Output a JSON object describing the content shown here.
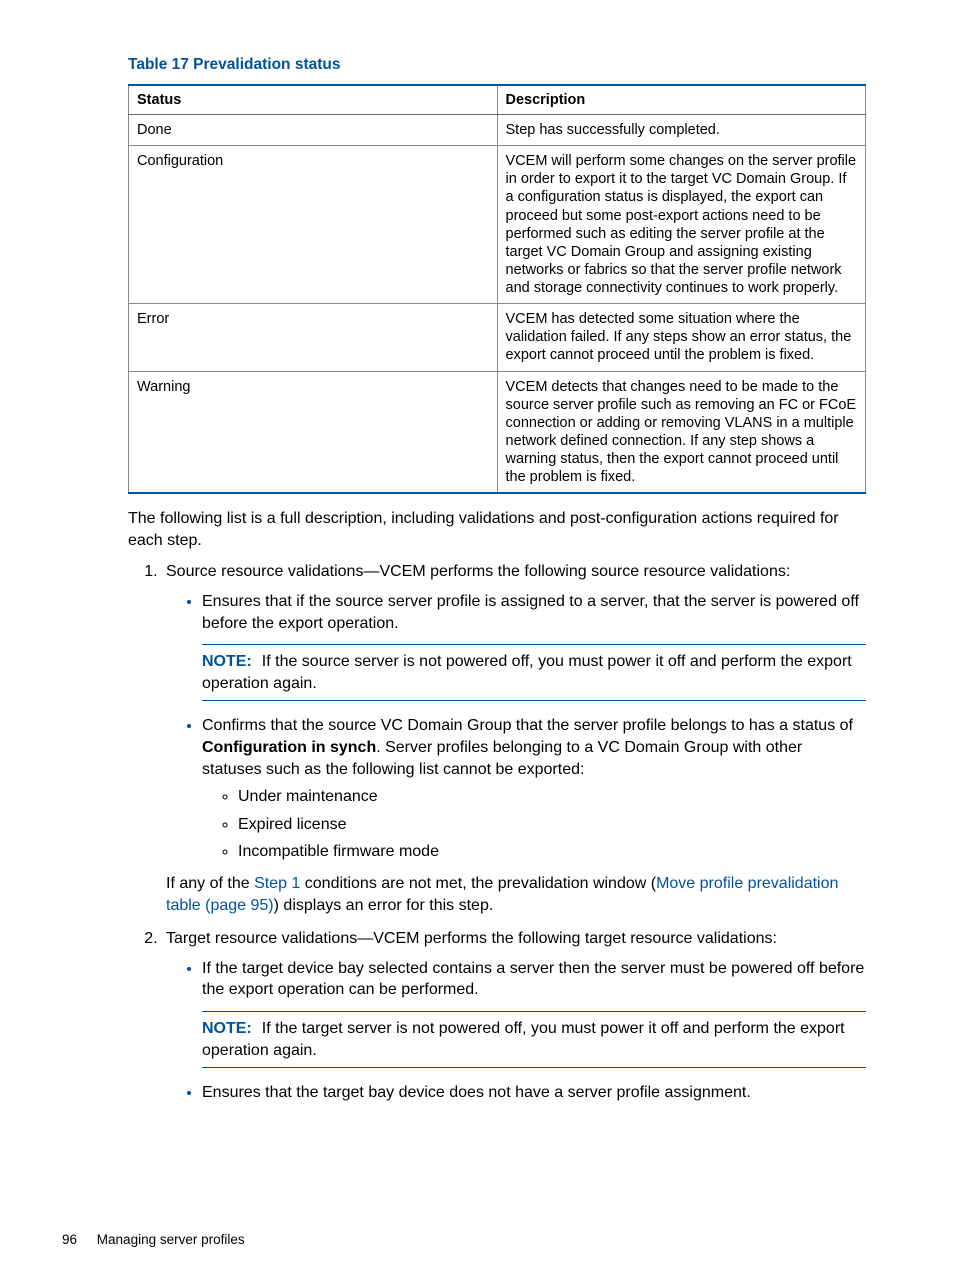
{
  "tableTitle": "Table 17 Prevalidation status",
  "headers": {
    "status": "Status",
    "description": "Description"
  },
  "rows": [
    {
      "status": "Done",
      "description": "Step has successfully completed."
    },
    {
      "status": "Configuration",
      "description": "VCEM will perform some changes on the server profile in order to export it to the target VC Domain Group. If a configuration status is displayed, the export can proceed but some post-export actions need to be performed such as editing the server profile at the target VC Domain Group and assigning existing networks or fabrics so that the server profile network and storage connectivity continues to work properly."
    },
    {
      "status": "Error",
      "description": "VCEM has detected some situation where the validation failed. If any steps show an error status, the export cannot proceed until the problem is fixed."
    },
    {
      "status": "Warning",
      "description": "VCEM detects that changes need to be made to the source server profile such as removing an FC or FCoE connection or adding or removing VLANS in a multiple network defined connection. If any step shows a warning status, then the export cannot proceed until the problem is fixed."
    }
  ],
  "intro": "The following list is a full description, including validations and post-configuration actions required for each step.",
  "step1Lead": "Source resource validations—VCEM performs the following source resource validations:",
  "step1Bullet1": "Ensures that if the source server profile is assigned to a server, that the server is powered off before the export operation.",
  "noteLabel": "NOTE:",
  "step1Note": "If the source server is not powered off, you must power it off and perform the export operation again.",
  "step1Bullet2a": "Confirms that the source VC Domain Group that the server profile belongs to has a status of ",
  "step1Bullet2Bold": "Configuration in synch",
  "step1Bullet2b": ". Server profiles belonging to a VC Domain Group with other statuses such as the following list cannot be exported:",
  "sub1": "Under maintenance",
  "sub2": "Expired license",
  "sub3": "Incompatible firmware mode",
  "step1Tail1": "If any of the ",
  "step1Link1": "Step 1",
  "step1Tail2": " conditions are not met, the prevalidation window (",
  "step1Link2": "Move profile prevalidation table (page 95)",
  "step1Tail3": ") displays an error for this step.",
  "step2Lead": "Target resource validations—VCEM performs the following target resource validations:",
  "step2Bullet1": "If the target device bay selected contains a server then the server must be powered off before the export operation can be performed.",
  "step2Note": "If the target server is not powered off, you must power it off and perform the export operation again.",
  "step2Bullet2": "Ensures that the target bay device does not have a server profile assignment.",
  "footerPage": "96",
  "footerSection": "Managing server profiles"
}
